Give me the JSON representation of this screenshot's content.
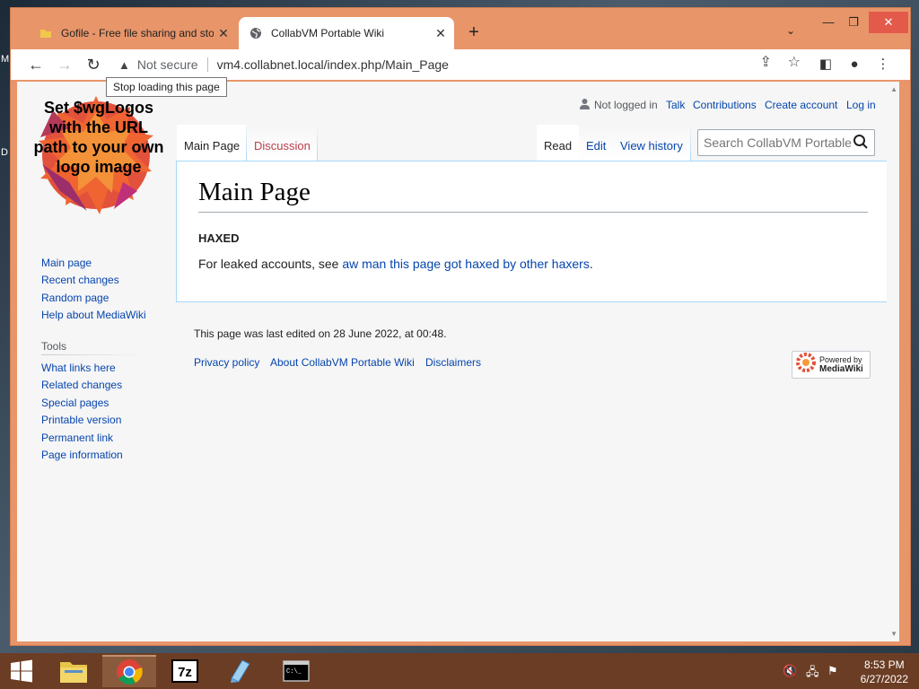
{
  "browser": {
    "tabs": [
      {
        "title": "Gofile - Free file sharing and stor",
        "active": false
      },
      {
        "title": "CollabVM Portable Wiki",
        "active": true
      }
    ],
    "new_tab_label": "+",
    "not_secure_label": "Not secure",
    "url": "vm4.collabnet.local/index.php/Main_Page",
    "tooltip": "Stop loading this page"
  },
  "wiki": {
    "logo_text": "Set $wgLogos with the URL path to your own logo image",
    "personal": [
      "Not logged in",
      "Talk",
      "Contributions",
      "Create account",
      "Log in"
    ],
    "left_tabs": [
      "Main Page",
      "Discussion"
    ],
    "right_tabs": [
      "Read",
      "Edit",
      "View history"
    ],
    "search_placeholder": "Search CollabVM Portable Wiki",
    "nav": [
      "Main page",
      "Recent changes",
      "Random page",
      "Help about MediaWiki"
    ],
    "tools_heading": "Tools",
    "tools": [
      "What links here",
      "Related changes",
      "Special pages",
      "Printable version",
      "Permanent link",
      "Page information"
    ],
    "title": "Main Page",
    "bold_line": "HAXED",
    "para_prefix": "For leaked accounts, see ",
    "para_link": "aw man this page got haxed by other haxers",
    "para_suffix": ".",
    "last_edited": "This page was last edited on 28 June 2022, at 00:48.",
    "footer_links": [
      "Privacy policy",
      "About CollabVM Portable Wiki",
      "Disclaimers"
    ],
    "powered_by": "Powered by",
    "powered_name": "MediaWiki"
  },
  "taskbar": {
    "time": "8:53 PM",
    "date": "6/27/2022"
  },
  "desktop_letters": [
    "M",
    "D"
  ],
  "colors": {
    "link": "#0645ad",
    "new_link": "#ba3c4c",
    "window_frame": "#e8956a",
    "taskbar": "#6b3d24"
  }
}
